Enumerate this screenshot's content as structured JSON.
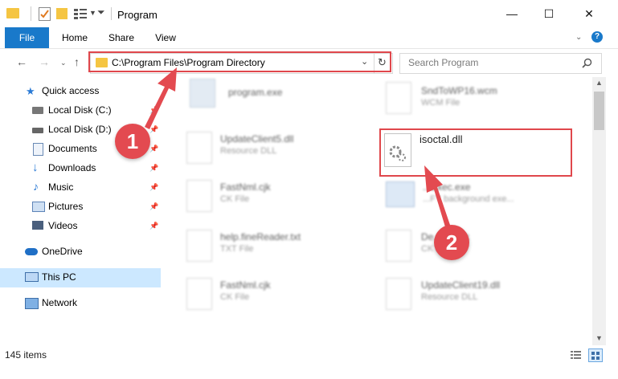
{
  "window": {
    "title": "Program",
    "controls": {
      "minimize": "—",
      "maximize": "☐",
      "close": "✕"
    }
  },
  "ribbon": {
    "tabs": [
      {
        "label": "File"
      },
      {
        "label": "Home"
      },
      {
        "label": "Share"
      },
      {
        "label": "View"
      }
    ]
  },
  "address": {
    "path": "C:\\Program Files\\Program Directory",
    "search_placeholder": "Search Program"
  },
  "sidebar": {
    "items": [
      {
        "label": "Quick access",
        "icon": "star-icon"
      },
      {
        "label": "Local Disk (C:)",
        "icon": "drive-icon",
        "pinned": true
      },
      {
        "label": "Local Disk (D:)",
        "icon": "drive-icon",
        "pinned": true
      },
      {
        "label": "Documents",
        "icon": "documents-icon",
        "pinned": true
      },
      {
        "label": "Downloads",
        "icon": "download-icon",
        "pinned": true
      },
      {
        "label": "Music",
        "icon": "music-icon",
        "pinned": true
      },
      {
        "label": "Pictures",
        "icon": "pictures-icon",
        "pinned": true
      },
      {
        "label": "Videos",
        "icon": "videos-icon",
        "pinned": true
      },
      {
        "label": "OneDrive",
        "icon": "cloud-icon"
      },
      {
        "label": "This PC",
        "icon": "computer-icon",
        "selected": true
      },
      {
        "label": "Network",
        "icon": "network-icon"
      }
    ]
  },
  "files": [
    {
      "name": "program.exe",
      "type": ""
    },
    {
      "name": "SndToWP16.wcm",
      "type": "WCM File"
    },
    {
      "name": "UpdateClient5.dll",
      "type": "Resource DLL"
    },
    {
      "name": "isoctal.dll",
      "type": ""
    },
    {
      "name": "FastNml.cjk",
      "type": "CK File"
    },
    {
      "name": "...Exec.exe",
      "type": "...FY background exe..."
    },
    {
      "name": "help.fineReader.txt",
      "type": "TXT File"
    },
    {
      "name": "De...ent.cjk",
      "type": "CK File"
    },
    {
      "name": "FastNml.cjk",
      "type": "CK File"
    },
    {
      "name": "UpdateClient19.dll",
      "type": "Resource DLL"
    }
  ],
  "status": {
    "item_count": "145 items"
  },
  "callouts": {
    "step1": "1",
    "step2": "2"
  },
  "colors": {
    "accent": "#1979ca",
    "highlight": "#e0474c",
    "callout": "#e34a50"
  }
}
